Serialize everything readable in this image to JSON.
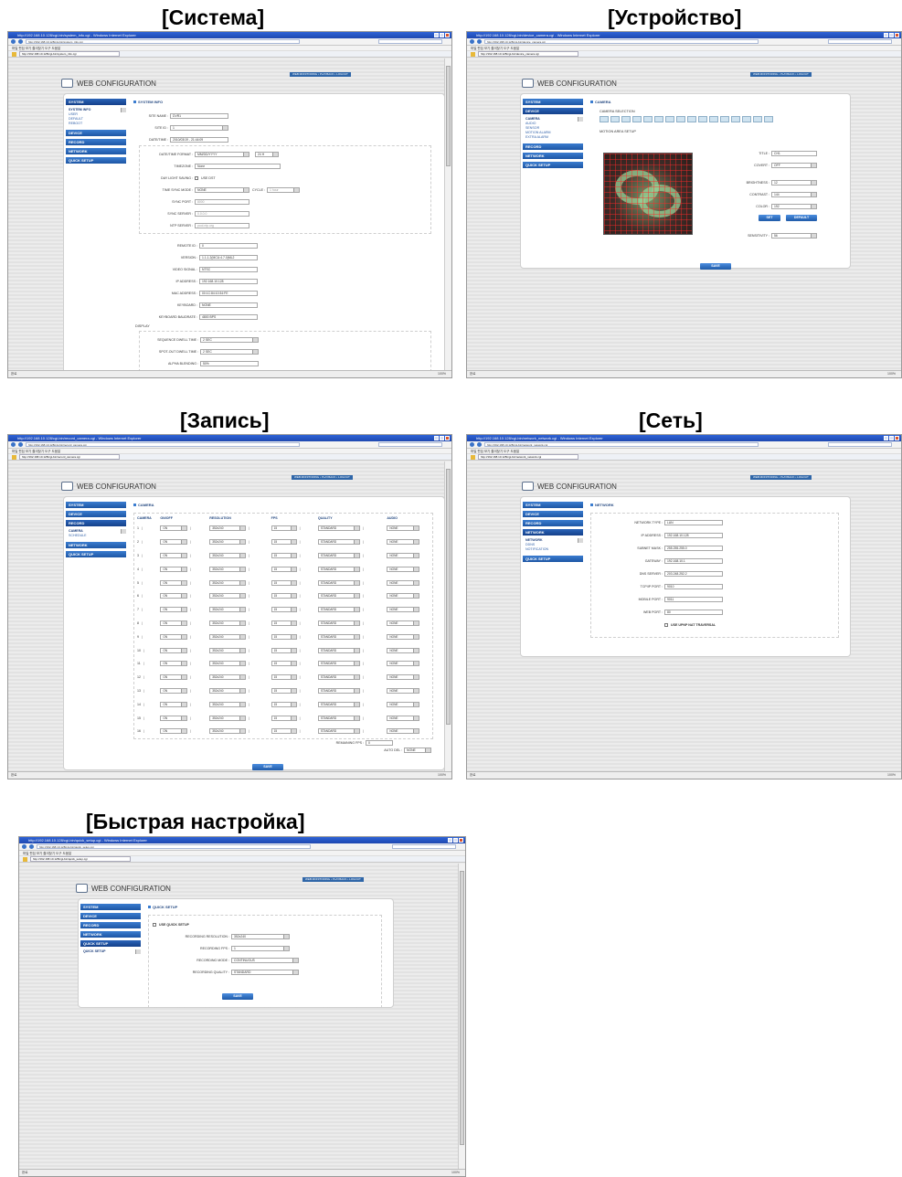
{
  "captions": {
    "system": "[Система]",
    "device": "[Устройство]",
    "record": "[Запись]",
    "network": "[Сеть]",
    "quick": "[Быстрая настройка]"
  },
  "browser": {
    "title_system": "http://192.168.10.128/cgi-bin/system_info.cgi - Windows Internet Explorer",
    "title_device": "http://192.168.10.128/cgi-bin/device_camera.cgi - Windows Internet Explorer",
    "title_record": "http://192.168.10.128/cgi-bin/record_camera.cgi - Windows Internet Explorer",
    "title_network": "http://192.168.10.128/cgi-bin/network_network.cgi - Windows Internet Explorer",
    "title_quick": "http://192.168.10.128/cgi-bin/quick_setup.cgi - Windows Internet Explorer",
    "url_system": "http://192.168.10.128/cgi-bin/system_info.cgi",
    "url_device": "http://192.168.10.128/cgi-bin/device_camera.cgi",
    "url_record": "http://192.168.10.128/cgi-bin/record_camera.cgi",
    "url_network": "http://192.168.10.128/cgi-bin/network_network.cgi",
    "url_quick": "http://192.168.10.128/cgi-bin/quick_setup.cgi",
    "menu": "파일  편집  보기  즐겨찾기  도구  도움말",
    "status_left": "완료",
    "zoom": "100%"
  },
  "app": {
    "logo": "WEB CONFIGURATION",
    "topnav": "WEB MONITORING  •  PLAYBACK  •  LOGOUT"
  },
  "sidebar": {
    "system": "SYSTEM",
    "device": "DEVICE",
    "record": "RECORD",
    "network": "NETWORK",
    "quick": "QUICK SETUP",
    "system_sub": [
      "SYSTEM INFO",
      "USER",
      "DEFAULT",
      "REBOOT"
    ],
    "device_sub": [
      "CAMERA",
      "AUDIO",
      "SENSOR",
      "MOTION ALARM",
      "EXTRA ALARM"
    ],
    "record_sub": [
      "CAMERA",
      "SCHEDULE"
    ],
    "network_sub": [
      "NETWORK",
      "DDNS",
      "NOTIFICATION"
    ],
    "quick_sub": [
      "QUICK SETUP"
    ]
  },
  "system_info": {
    "heading": "SYSTEM INFO",
    "site_name_label": "SITE NAME :",
    "site_name": "DVR1",
    "site_id_label": "SITE ID :",
    "site_id": "1",
    "datetime_label": "DATE/TIME :",
    "datetime": "2010/03/19 - 21:44:09",
    "dt_format_label": "DATE/TIME FORMAT :",
    "dt_format": "MM/DD/YYYY",
    "hour_format": "24 H",
    "timezone_label": "TIMEZONE :",
    "timezone": "None",
    "dst_label": "DAY LIGHT SAVING :",
    "dst_check": "USE DST",
    "sync_mode_label": "TIME SYNC MODE :",
    "sync_mode": "NONE",
    "cycle_label": "CYCLE :",
    "cycle": "1 hour",
    "sync_port_label": "SYNC PORT :",
    "sync_port": "8000",
    "sync_server_label": "SYNC SERVER :",
    "sync_server": "0.0.0.0",
    "ntp_label": "NTP SERVER :",
    "ntp": "pool.ntp.org",
    "remote_id_label": "REMOTE ID :",
    "remote_id": "0",
    "version_label": "VERSION :",
    "version": "1.1.1.2(MCU:4.7.0)ML2",
    "video_signal_label": "VIDEO SIGNAL :",
    "video_signal": "NTSC",
    "ip_label": "IP ADDRESS :",
    "ip": "192.168.10.128",
    "mac_label": "MAC ADDRESS :",
    "mac": "00:1C:84:10:34:FE",
    "keyboard_label": "KEYBOARD :",
    "keyboard": "NONE",
    "baud_label": "KEYBOARD BAUDRATE :",
    "baud": "4800 BPS",
    "display_label": "DISPLAY",
    "seq_label": "SEQUENCE DWELL TIME :",
    "seq": "2 SEC",
    "spot_label": "SPOT-OUT DWELL TIME :",
    "spot": "2 SEC",
    "alpha_label": "ALPHA BLENDING :",
    "alpha": "50%"
  },
  "device": {
    "heading": "CAMERA",
    "cam_select": "CAMERA SELECTION",
    "motion_area": "MOTION AREA SETUP",
    "title_label": "TITLE :",
    "title": "CH1",
    "covert_label": "COVERT :",
    "covert": "OFF",
    "brightness_label": "BRIGHTNESS :",
    "brightness": "12",
    "contrast_label": "CONTRAST :",
    "contrast": "144",
    "color_label": "COLOR :",
    "color": "192",
    "set": "SET",
    "default": "DEFAULT",
    "sensitivity_label": "SENSITIVITY :",
    "sensitivity": "56",
    "save": "SAVE"
  },
  "record": {
    "heading": "CAMERA",
    "columns": [
      "CAMERA",
      "ON/OFF",
      "RESOLUTION",
      "FPS",
      "QUALITY",
      "AUDIO"
    ],
    "rows": [
      {
        "cam": "1",
        "on": "ON",
        "res": "352x240",
        "fps": "15",
        "q": "STANDARD",
        "a": "NONE"
      },
      {
        "cam": "2",
        "on": "ON",
        "res": "352x240",
        "fps": "15",
        "q": "STANDARD",
        "a": "NONE"
      },
      {
        "cam": "3",
        "on": "ON",
        "res": "352x240",
        "fps": "15",
        "q": "STANDARD",
        "a": "NONE"
      },
      {
        "cam": "4",
        "on": "ON",
        "res": "352x240",
        "fps": "15",
        "q": "STANDARD",
        "a": "NONE"
      },
      {
        "cam": "5",
        "on": "ON",
        "res": "352x240",
        "fps": "15",
        "q": "STANDARD",
        "a": "NONE"
      },
      {
        "cam": "6",
        "on": "ON",
        "res": "352x240",
        "fps": "15",
        "q": "STANDARD",
        "a": "NONE"
      },
      {
        "cam": "7",
        "on": "ON",
        "res": "352x240",
        "fps": "15",
        "q": "STANDARD",
        "a": "NONE"
      },
      {
        "cam": "8",
        "on": "ON",
        "res": "352x240",
        "fps": "15",
        "q": "STANDARD",
        "a": "NONE"
      },
      {
        "cam": "9",
        "on": "ON",
        "res": "352x240",
        "fps": "15",
        "q": "STANDARD",
        "a": "NONE"
      },
      {
        "cam": "10",
        "on": "ON",
        "res": "352x240",
        "fps": "15",
        "q": "STANDARD",
        "a": "NONE"
      },
      {
        "cam": "11",
        "on": "ON",
        "res": "352x240",
        "fps": "15",
        "q": "STANDARD",
        "a": "NONE"
      },
      {
        "cam": "12",
        "on": "ON",
        "res": "352x240",
        "fps": "15",
        "q": "STANDARD",
        "a": "NONE"
      },
      {
        "cam": "13",
        "on": "ON",
        "res": "352x240",
        "fps": "15",
        "q": "STANDARD",
        "a": "NONE"
      },
      {
        "cam": "14",
        "on": "ON",
        "res": "352x240",
        "fps": "15",
        "q": "STANDARD",
        "a": "NONE"
      },
      {
        "cam": "15",
        "on": "ON",
        "res": "352x240",
        "fps": "15",
        "q": "STANDARD",
        "a": "NONE"
      },
      {
        "cam": "16",
        "on": "ON",
        "res": "352x240",
        "fps": "15",
        "q": "STANDARD",
        "a": "NONE"
      }
    ],
    "remaining_label": "REMAINING FPS :",
    "remaining": "0",
    "autodel_label": "AUTO DEL :",
    "autodel": "NONE",
    "save": "SAVE"
  },
  "network": {
    "heading": "NETWORK",
    "type_label": "NETWORK TYPE :",
    "type": "LAN",
    "ip_label": "IP ADDRESS :",
    "ip": "192.168.10.128",
    "mask_label": "SUBNET MASK :",
    "mask": "255.255.255.0",
    "gw_label": "GATEWAY :",
    "gw": "192.168.10.1",
    "dns_label": "DNS SERVER :",
    "dns": "203.248.252.2",
    "tcp_label": "TCP/IP PORT :",
    "tcp": "9010",
    "mobile_label": "MOBILE PORT :",
    "mobile": "9011",
    "web_label": "WEB PORT :",
    "web": "80",
    "upnp": "USE UPNP NAT TRAVERSAL"
  },
  "quick": {
    "heading": "QUICK SETUP",
    "use": "USE QUICK SETUP",
    "res_label": "RECORDING RESOLUTION :",
    "res": "352x240",
    "fps_label": "RECORDING FPS :",
    "fps": "1",
    "mode_label": "RECORDING MODE :",
    "mode": "CONTINUOUS",
    "quality_label": "RECORDING QUALITY :",
    "quality": "STANDARD",
    "save": "SAVE"
  }
}
